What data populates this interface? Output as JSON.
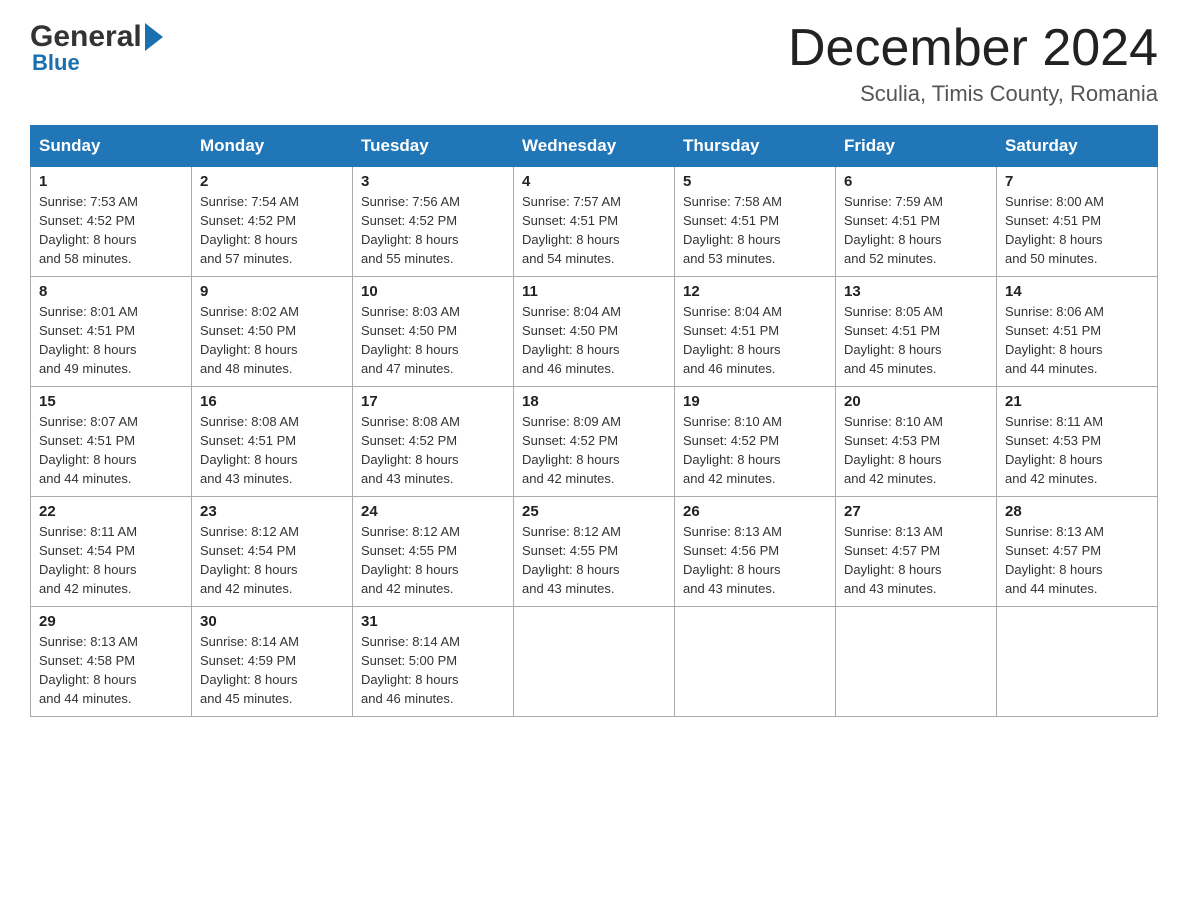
{
  "logo": {
    "text1": "General",
    "text2": "Blue"
  },
  "title": "December 2024",
  "location": "Sculia, Timis County, Romania",
  "days_header": [
    "Sunday",
    "Monday",
    "Tuesday",
    "Wednesday",
    "Thursday",
    "Friday",
    "Saturday"
  ],
  "weeks": [
    [
      {
        "day": "1",
        "sunrise": "7:53 AM",
        "sunset": "4:52 PM",
        "daylight": "8 hours and 58 minutes."
      },
      {
        "day": "2",
        "sunrise": "7:54 AM",
        "sunset": "4:52 PM",
        "daylight": "8 hours and 57 minutes."
      },
      {
        "day": "3",
        "sunrise": "7:56 AM",
        "sunset": "4:52 PM",
        "daylight": "8 hours and 55 minutes."
      },
      {
        "day": "4",
        "sunrise": "7:57 AM",
        "sunset": "4:51 PM",
        "daylight": "8 hours and 54 minutes."
      },
      {
        "day": "5",
        "sunrise": "7:58 AM",
        "sunset": "4:51 PM",
        "daylight": "8 hours and 53 minutes."
      },
      {
        "day": "6",
        "sunrise": "7:59 AM",
        "sunset": "4:51 PM",
        "daylight": "8 hours and 52 minutes."
      },
      {
        "day": "7",
        "sunrise": "8:00 AM",
        "sunset": "4:51 PM",
        "daylight": "8 hours and 50 minutes."
      }
    ],
    [
      {
        "day": "8",
        "sunrise": "8:01 AM",
        "sunset": "4:51 PM",
        "daylight": "8 hours and 49 minutes."
      },
      {
        "day": "9",
        "sunrise": "8:02 AM",
        "sunset": "4:50 PM",
        "daylight": "8 hours and 48 minutes."
      },
      {
        "day": "10",
        "sunrise": "8:03 AM",
        "sunset": "4:50 PM",
        "daylight": "8 hours and 47 minutes."
      },
      {
        "day": "11",
        "sunrise": "8:04 AM",
        "sunset": "4:50 PM",
        "daylight": "8 hours and 46 minutes."
      },
      {
        "day": "12",
        "sunrise": "8:04 AM",
        "sunset": "4:51 PM",
        "daylight": "8 hours and 46 minutes."
      },
      {
        "day": "13",
        "sunrise": "8:05 AM",
        "sunset": "4:51 PM",
        "daylight": "8 hours and 45 minutes."
      },
      {
        "day": "14",
        "sunrise": "8:06 AM",
        "sunset": "4:51 PM",
        "daylight": "8 hours and 44 minutes."
      }
    ],
    [
      {
        "day": "15",
        "sunrise": "8:07 AM",
        "sunset": "4:51 PM",
        "daylight": "8 hours and 44 minutes."
      },
      {
        "day": "16",
        "sunrise": "8:08 AM",
        "sunset": "4:51 PM",
        "daylight": "8 hours and 43 minutes."
      },
      {
        "day": "17",
        "sunrise": "8:08 AM",
        "sunset": "4:52 PM",
        "daylight": "8 hours and 43 minutes."
      },
      {
        "day": "18",
        "sunrise": "8:09 AM",
        "sunset": "4:52 PM",
        "daylight": "8 hours and 42 minutes."
      },
      {
        "day": "19",
        "sunrise": "8:10 AM",
        "sunset": "4:52 PM",
        "daylight": "8 hours and 42 minutes."
      },
      {
        "day": "20",
        "sunrise": "8:10 AM",
        "sunset": "4:53 PM",
        "daylight": "8 hours and 42 minutes."
      },
      {
        "day": "21",
        "sunrise": "8:11 AM",
        "sunset": "4:53 PM",
        "daylight": "8 hours and 42 minutes."
      }
    ],
    [
      {
        "day": "22",
        "sunrise": "8:11 AM",
        "sunset": "4:54 PM",
        "daylight": "8 hours and 42 minutes."
      },
      {
        "day": "23",
        "sunrise": "8:12 AM",
        "sunset": "4:54 PM",
        "daylight": "8 hours and 42 minutes."
      },
      {
        "day": "24",
        "sunrise": "8:12 AM",
        "sunset": "4:55 PM",
        "daylight": "8 hours and 42 minutes."
      },
      {
        "day": "25",
        "sunrise": "8:12 AM",
        "sunset": "4:55 PM",
        "daylight": "8 hours and 43 minutes."
      },
      {
        "day": "26",
        "sunrise": "8:13 AM",
        "sunset": "4:56 PM",
        "daylight": "8 hours and 43 minutes."
      },
      {
        "day": "27",
        "sunrise": "8:13 AM",
        "sunset": "4:57 PM",
        "daylight": "8 hours and 43 minutes."
      },
      {
        "day": "28",
        "sunrise": "8:13 AM",
        "sunset": "4:57 PM",
        "daylight": "8 hours and 44 minutes."
      }
    ],
    [
      {
        "day": "29",
        "sunrise": "8:13 AM",
        "sunset": "4:58 PM",
        "daylight": "8 hours and 44 minutes."
      },
      {
        "day": "30",
        "sunrise": "8:14 AM",
        "sunset": "4:59 PM",
        "daylight": "8 hours and 45 minutes."
      },
      {
        "day": "31",
        "sunrise": "8:14 AM",
        "sunset": "5:00 PM",
        "daylight": "8 hours and 46 minutes."
      },
      null,
      null,
      null,
      null
    ]
  ],
  "labels": {
    "sunrise": "Sunrise:",
    "sunset": "Sunset:",
    "daylight": "Daylight:"
  }
}
